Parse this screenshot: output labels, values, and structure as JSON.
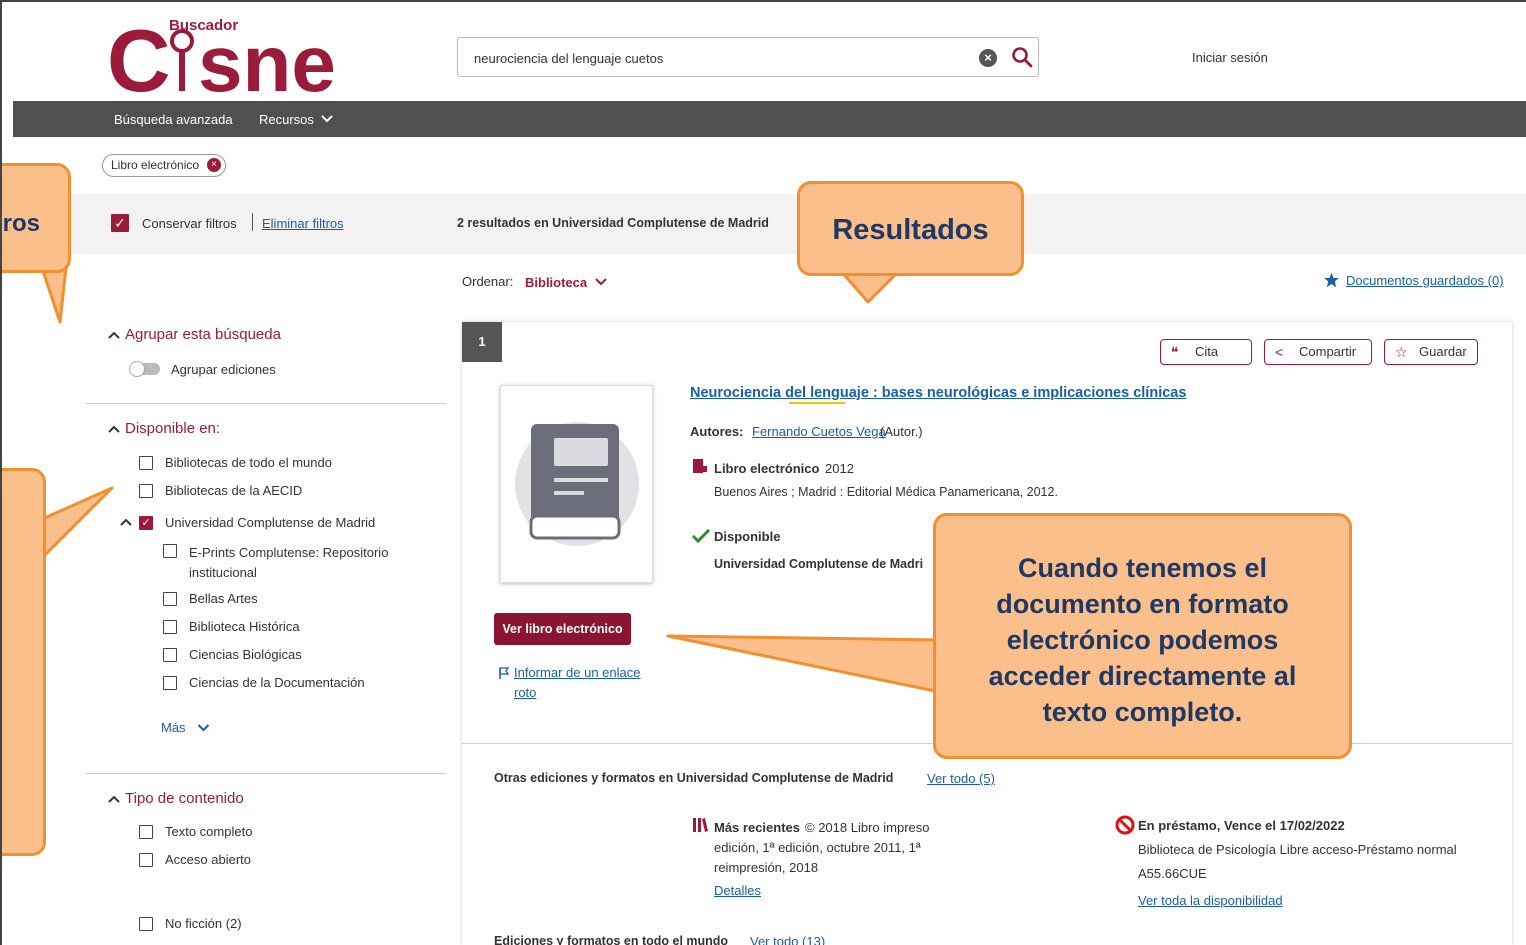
{
  "header": {
    "logo_small": "Buscador",
    "logo_big": "Cisne",
    "search_value": "neurociencia del lenguaje cuetos",
    "login_label": "Iniciar sesión"
  },
  "nav": {
    "advanced": "Búsqueda avanzada",
    "resources": "Recursos"
  },
  "active_filter": "Libro electrónico",
  "toolbar": {
    "keep_filters": "Conservar filtros",
    "clear_filters": "Eliminar filtros",
    "results_count": "2 resultados en Universidad Complutense de Madrid"
  },
  "sort": {
    "label": "Ordenar:",
    "value": "Biblioteca",
    "saved": "Documentos guardados (0)"
  },
  "sidebar": {
    "group_head": "Agrupar esta búsqueda",
    "group_toggle": "Agrupar ediciones",
    "available_head": "Disponible en:",
    "available": [
      "Bibliotecas de todo el mundo",
      "Bibliotecas de la AECID",
      "Universidad Complutense de Madrid"
    ],
    "sub_libs": [
      "E-Prints Complutense: Repositorio institucional",
      "Bellas Artes",
      "Biblioteca Histórica",
      "Ciencias Biológicas",
      "Ciencias de la Documentación"
    ],
    "more": "Más",
    "content_head": "Tipo de contenido",
    "content": [
      "Texto completo",
      "Acceso abierto"
    ],
    "nonfiction": "No ficción (2)"
  },
  "result": {
    "rank": "1",
    "btn_cite": "Cita",
    "btn_share": "Compartir",
    "btn_save": "Guardar",
    "title": "Neurociencia del lenguaje : bases neurológicas e implicaciones clínicas",
    "authors_label": "Autores:",
    "author": "Fernando Cuetos Vega",
    "author_role": "(Autor.)",
    "format": "Libro electrónico",
    "year": "2012",
    "publisher": "Buenos Aires ; Madrid : Editorial Médica Panamericana, 2012.",
    "available": "Disponible",
    "library": "Universidad Complutense de Madri",
    "ebook_button": "Ver libro electrónico",
    "report_link_1": "Informar de un enlace",
    "report_link_2": "roto",
    "other_editions": "Otras ediciones y formatos en Universidad Complutense de Madrid",
    "see_all": "Ver todo (5)",
    "recent_label": "Más recientes",
    "recent_line1": "© 2018 Libro impreso",
    "recent_line2": "edición, 1ª edición, octubre 2011, 1ª",
    "recent_line3": "reimpresión, 2018",
    "details": "Detalles",
    "loan_status": "En préstamo, Vence el 17/02/2022",
    "loan_location": "Biblioteca de Psicología Libre acceso-Préstamo normal",
    "loan_callno": "A55.66CUE",
    "loan_all": "Ver toda la disponibilidad",
    "world_editions": "Ediciones y formatos en todo el mundo",
    "world_see_all": "Ver todo (13)"
  },
  "callouts": {
    "left_partial": "ros",
    "results": "Resultados",
    "ebook_note": "Cuando tenemos el documento en formato electrónico podemos acceder directamente al texto completo."
  },
  "colors": {
    "brand": "#9b1c3a",
    "navbar": "#505050",
    "callout_fill": "#fbbf8c",
    "callout_border": "#f0902f",
    "callout_text": "#1f3864"
  }
}
